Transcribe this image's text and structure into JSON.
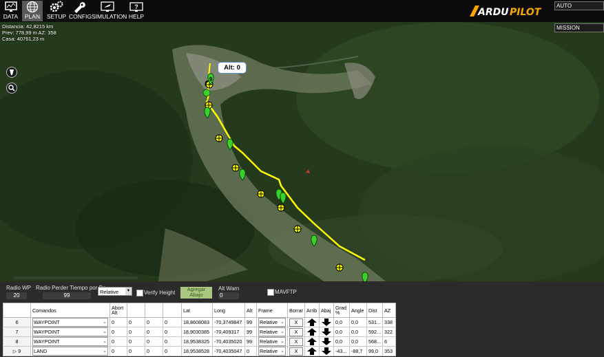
{
  "toolbar": {
    "items": [
      {
        "label": "DATA",
        "icon": "data-monitor-icon"
      },
      {
        "label": "PLAN",
        "icon": "globe-icon",
        "active": true
      },
      {
        "label": "SETUP",
        "icon": "gear-setup-icon"
      },
      {
        "label": "CONFIG",
        "icon": "wrench-icon"
      },
      {
        "label": "SIMULATION",
        "icon": "simulation-plane-icon"
      },
      {
        "label": "HELP",
        "icon": "help-monitor-icon"
      }
    ],
    "brand": "ARDUPILOT",
    "mode_value": "AUTO",
    "view_value": "MISSION"
  },
  "map": {
    "distance": "Distancia: 42,8215 km",
    "prev": "Prev: 778,99 m AZ: 358",
    "home": "Casa: 40761,23 m",
    "alt_badge": "Alt: 0",
    "current_wp_label": "9",
    "route_color": "#ffff00",
    "marker_color": "#39d12b"
  },
  "panel": {
    "radio_wp_label": "Radio WP",
    "radio_wp_value": "20",
    "loiter_label": "Radio Perder Tiempo por De",
    "loiter_value": "99",
    "frame_value": "Relative",
    "verify_height_label": "Verify Height",
    "add_below_label": "Agregar Abajo",
    "alt_warn_label": "Alt Warn",
    "alt_warn_value": "0",
    "mavftp_label": "MAVFTP"
  },
  "table": {
    "headers": [
      "",
      "Comandos",
      "Abort Alt",
      "",
      "",
      "",
      "Lat",
      "Long",
      "Alt",
      "Frame",
      "Borrar",
      "Arrib",
      "Abaj",
      "Grad %",
      "Angle",
      "Dist",
      "AZ"
    ],
    "rows": [
      {
        "num": "6",
        "cmd": "WAYPOINT",
        "p1": "0",
        "p2": "0",
        "p3": "0",
        "p4": "0",
        "lat": "18,8608083",
        "long": "-70,3749847",
        "alt": "99",
        "frame": "Relative",
        "del": "X",
        "grad": "0,0",
        "angle": "0,0",
        "dist": "531...",
        "az": "338"
      },
      {
        "num": "7",
        "cmd": "WAYPOINT",
        "p1": "0",
        "p2": "0",
        "p3": "0",
        "p4": "0",
        "lat": "18,9030385",
        "long": "-70,409317",
        "alt": "99",
        "frame": "Relative",
        "del": "X",
        "grad": "0,0",
        "angle": "0,0",
        "dist": "592...",
        "az": "322"
      },
      {
        "num": "8",
        "cmd": "WAYPOINT",
        "p1": "0",
        "p2": "0",
        "p3": "0",
        "p4": "0",
        "lat": "18,9538325",
        "long": "-70,4035020",
        "alt": "99",
        "frame": "Relative",
        "del": "X",
        "grad": "0,0",
        "angle": "0,0",
        "dist": "568...",
        "az": "6"
      },
      {
        "num": "9",
        "cmd": "LAND",
        "p1": "0",
        "p2": "0",
        "p3": "0",
        "p4": "0",
        "lat": "18,9538528",
        "long": "-70,4035047",
        "alt": "0",
        "frame": "Relative",
        "del": "X",
        "grad": "-43...",
        "angle": "-88,7",
        "dist": "99,0",
        "az": "353"
      }
    ]
  }
}
